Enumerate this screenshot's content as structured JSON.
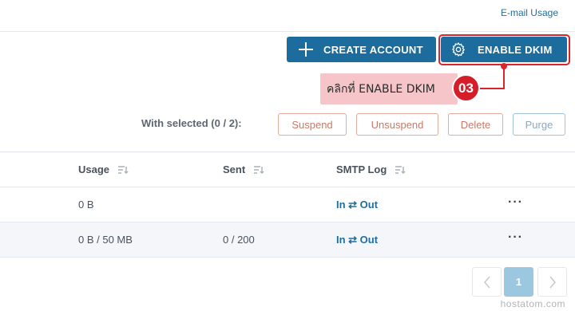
{
  "top_link": "E-mail Usage",
  "actions": {
    "create_label": "CREATE ACCOUNT",
    "dkim_label": "ENABLE DKIM"
  },
  "annotation": {
    "text": "คลิกที่ ENABLE DKIM",
    "step": "03",
    "color": "#d9262e"
  },
  "bulk": {
    "label": "With selected (0 / 2):",
    "suspend": "Suspend",
    "unsuspend": "Unsuspend",
    "delete": "Delete",
    "purge": "Purge"
  },
  "table": {
    "columns": [
      "Usage",
      "Sent",
      "SMTP Log"
    ],
    "rows": [
      {
        "usage": "0 B",
        "sent": "",
        "smtp": "In ⇄ Out",
        "more": "···"
      },
      {
        "usage": "0 B / 50 MB",
        "sent": "0 / 200",
        "smtp": "In ⇄ Out",
        "more": "···"
      }
    ]
  },
  "pagination": {
    "current": "1"
  },
  "watermark": "hostatom.com",
  "colors": {
    "primary": "#1d6c9e",
    "link": "#1f6e9e",
    "danger_outline": "#e2ad9e"
  },
  "icons": [
    "plus-icon",
    "gear-icon",
    "sort-icon",
    "chevron-left-icon",
    "chevron-right-icon",
    "more-icon"
  ]
}
